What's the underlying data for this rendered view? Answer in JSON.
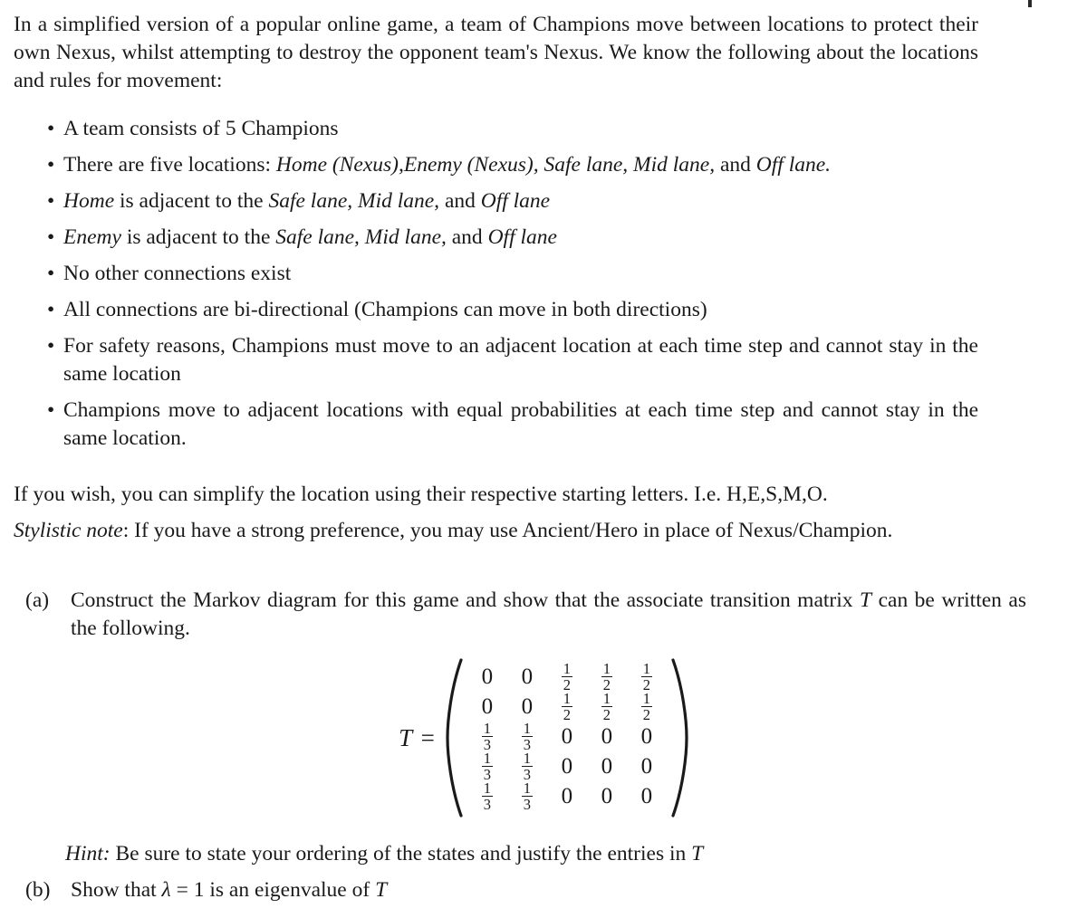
{
  "document": {
    "type": "math-problem-statement",
    "intro": {
      "text": "In a simplified version of a popular online game, a team of Champions move between locations to protect their own Nexus, whilst attempting to destroy the opponent team's Nexus. We know the following about the locations and rules for movement:"
    },
    "bullets": [
      {
        "id": "team-size",
        "segments": [
          {
            "style": "roman",
            "text": "A team consists of 5 Champions"
          }
        ]
      },
      {
        "id": "locations-list",
        "segments": [
          {
            "style": "roman",
            "text": "There are five locations:  "
          },
          {
            "style": "italic",
            "text": "Home (Nexus),Enemy (Nexus), Safe lane, Mid lane,"
          },
          {
            "style": "roman",
            "text": " and "
          },
          {
            "style": "italic",
            "text": "Off lane."
          }
        ]
      },
      {
        "id": "home-adjacency",
        "segments": [
          {
            "style": "italic",
            "text": "Home"
          },
          {
            "style": "roman",
            "text": " is adjacent to the "
          },
          {
            "style": "italic",
            "text": "Safe lane, Mid lane,"
          },
          {
            "style": "roman",
            "text": " and "
          },
          {
            "style": "italic",
            "text": "Off lane"
          }
        ]
      },
      {
        "id": "enemy-adjacency",
        "segments": [
          {
            "style": "italic",
            "text": "Enemy"
          },
          {
            "style": "roman",
            "text": " is adjacent to the "
          },
          {
            "style": "italic",
            "text": "Safe lane, Mid lane,"
          },
          {
            "style": "roman",
            "text": " and "
          },
          {
            "style": "italic",
            "text": "Off lane"
          }
        ]
      },
      {
        "id": "no-other-connections",
        "segments": [
          {
            "style": "roman",
            "text": "No other connections exist"
          }
        ]
      },
      {
        "id": "bidirectional",
        "segments": [
          {
            "style": "roman",
            "text": "All connections are bi-directional (Champions can move in both directions)"
          }
        ]
      },
      {
        "id": "must-move",
        "segments": [
          {
            "style": "roman",
            "text": "For safety reasons, Champions must move to an adjacent location at each time step and cannot stay in the same location"
          }
        ]
      },
      {
        "id": "equal-probabilities",
        "segments": [
          {
            "style": "roman",
            "text": "Champions move to adjacent locations with equal probabilities at each time step and cannot stay in the same location."
          }
        ]
      }
    ],
    "closing": [
      {
        "id": "simplify-letters",
        "segments": [
          {
            "style": "roman",
            "text": "If you wish, you can simplify the location using their respective starting letters.  I.e.  H,E,S,M,O."
          }
        ]
      },
      {
        "id": "stylistic-note",
        "segments": [
          {
            "style": "italic",
            "text": "Stylistic note"
          },
          {
            "style": "roman",
            "text": ":  If you have a strong preference, you may use Ancient/Hero in place of Nexus/Champion."
          }
        ]
      }
    ],
    "parts": [
      {
        "label": "(a)",
        "segments": [
          {
            "style": "roman",
            "text": "Construct the Markov diagram for this game and show that the associate transition matrix "
          },
          {
            "style": "math",
            "text": "T"
          },
          {
            "style": "roman",
            "text": " can be written as the following."
          }
        ]
      },
      {
        "label": "(b)",
        "segments": [
          {
            "style": "roman",
            "text": "Show that "
          },
          {
            "style": "math",
            "text": "λ"
          },
          {
            "style": "roman",
            "text": " = 1 is an eigenvalue of "
          },
          {
            "style": "math",
            "text": "T"
          }
        ]
      }
    ],
    "hint": {
      "label": "Hint:",
      "segments": [
        {
          "style": "roman",
          "text": "Be sure to state your ordering of the states and justify the entries in "
        },
        {
          "style": "math",
          "text": "T"
        }
      ]
    },
    "matrix": {
      "name": "T",
      "equals": "=",
      "rows": [
        [
          "0",
          "0",
          "1/2",
          "1/2",
          "1/2"
        ],
        [
          "0",
          "0",
          "1/2",
          "1/2",
          "1/2"
        ],
        [
          "1/3",
          "1/3",
          "0",
          "0",
          "0"
        ],
        [
          "1/3",
          "1/3",
          "0",
          "0",
          "0"
        ],
        [
          "1/3",
          "1/3",
          "0",
          "0",
          "0"
        ]
      ]
    }
  },
  "colors": {
    "ink": "#1a1a1a",
    "paper": "#ffffff"
  }
}
